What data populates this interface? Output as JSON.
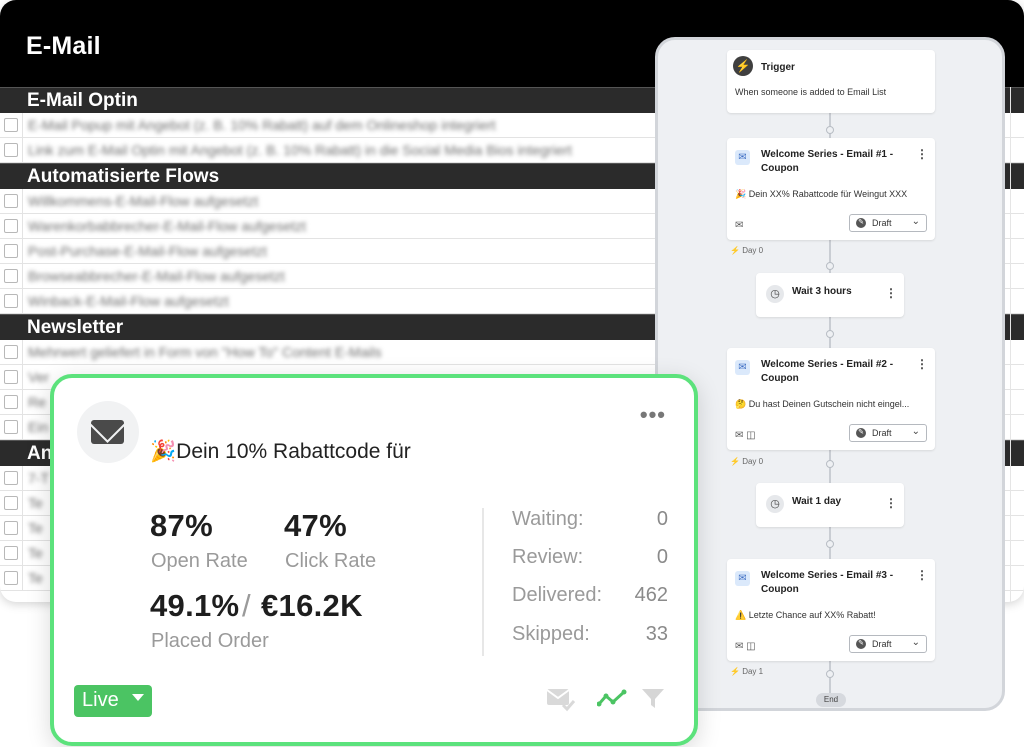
{
  "sheet": {
    "title": "E-Mail",
    "sections": [
      {
        "name": "E-Mail Optin",
        "rows": [
          "E-Mail Popup mit Angebot (z. B. 10% Rabatt) auf dem Onlineshop integriert",
          "Link zum E-Mail Optin mit Angebot (z. B. 10% Rabatt) in die Social Media Bios integriert"
        ]
      },
      {
        "name": "Automatisierte Flows",
        "rows": [
          "Willkommens-E-Mail-Flow aufgesetzt",
          "Warenkorbabbrecher-E-Mail-Flow aufgesetzt",
          "Post-Purchase-E-Mail-Flow aufgesetzt",
          "Browseabbrecher-E-Mail-Flow aufgesetzt",
          "Winback-E-Mail-Flow aufgesetzt"
        ]
      },
      {
        "name": "Newsletter",
        "rows": [
          "Mehrwert geliefert in Form von \"How To\" Content E-Mails",
          "Ver",
          "Re",
          "Ein"
        ]
      },
      {
        "name": "An",
        "rows": [
          "7-T",
          "Te",
          "Te",
          "Te",
          "Te"
        ]
      }
    ]
  },
  "flow": {
    "trigger": {
      "label": "Trigger",
      "text": "When someone is added to Email List"
    },
    "emails": [
      {
        "title_line1": "Welcome Series - Email #1 -",
        "title_line2": "Coupon",
        "subject": "🎉 Dein XX% Rabattcode für Weingut XXX",
        "status": "Draft",
        "day": "Day 0"
      },
      {
        "title_line1": "Welcome Series - Email #2 -",
        "title_line2": "Coupon",
        "subject": "🤔 Du hast Deinen Gutschein nicht eingel...",
        "status": "Draft",
        "day": "Day 0"
      },
      {
        "title_line1": "Welcome Series - Email #3 -",
        "title_line2": "Coupon",
        "subject": "⚠️ Letzte Chance auf XX% Rabatt!",
        "status": "Draft",
        "day": "Day 1"
      }
    ],
    "waits": [
      "Wait 3 hours",
      "Wait 1 day"
    ],
    "end": "End"
  },
  "stats": {
    "title": "🎉Dein 10% Rabattcode für",
    "open_rate": "87%",
    "open_rate_label": "Open Rate",
    "click_rate": "47%",
    "click_rate_label": "Click Rate",
    "placed_pct": "49.1%",
    "placed_sep": "/",
    "placed_value": "€16.2K",
    "placed_label": "Placed Order",
    "counts": [
      {
        "label": "Waiting:",
        "value": "0"
      },
      {
        "label": "Review:",
        "value": "0"
      },
      {
        "label": "Delivered:",
        "value": "462"
      },
      {
        "label": "Skipped:",
        "value": "33"
      }
    ],
    "status": "Live",
    "accent": "#5ce27c",
    "live_color": "#4bc463"
  }
}
